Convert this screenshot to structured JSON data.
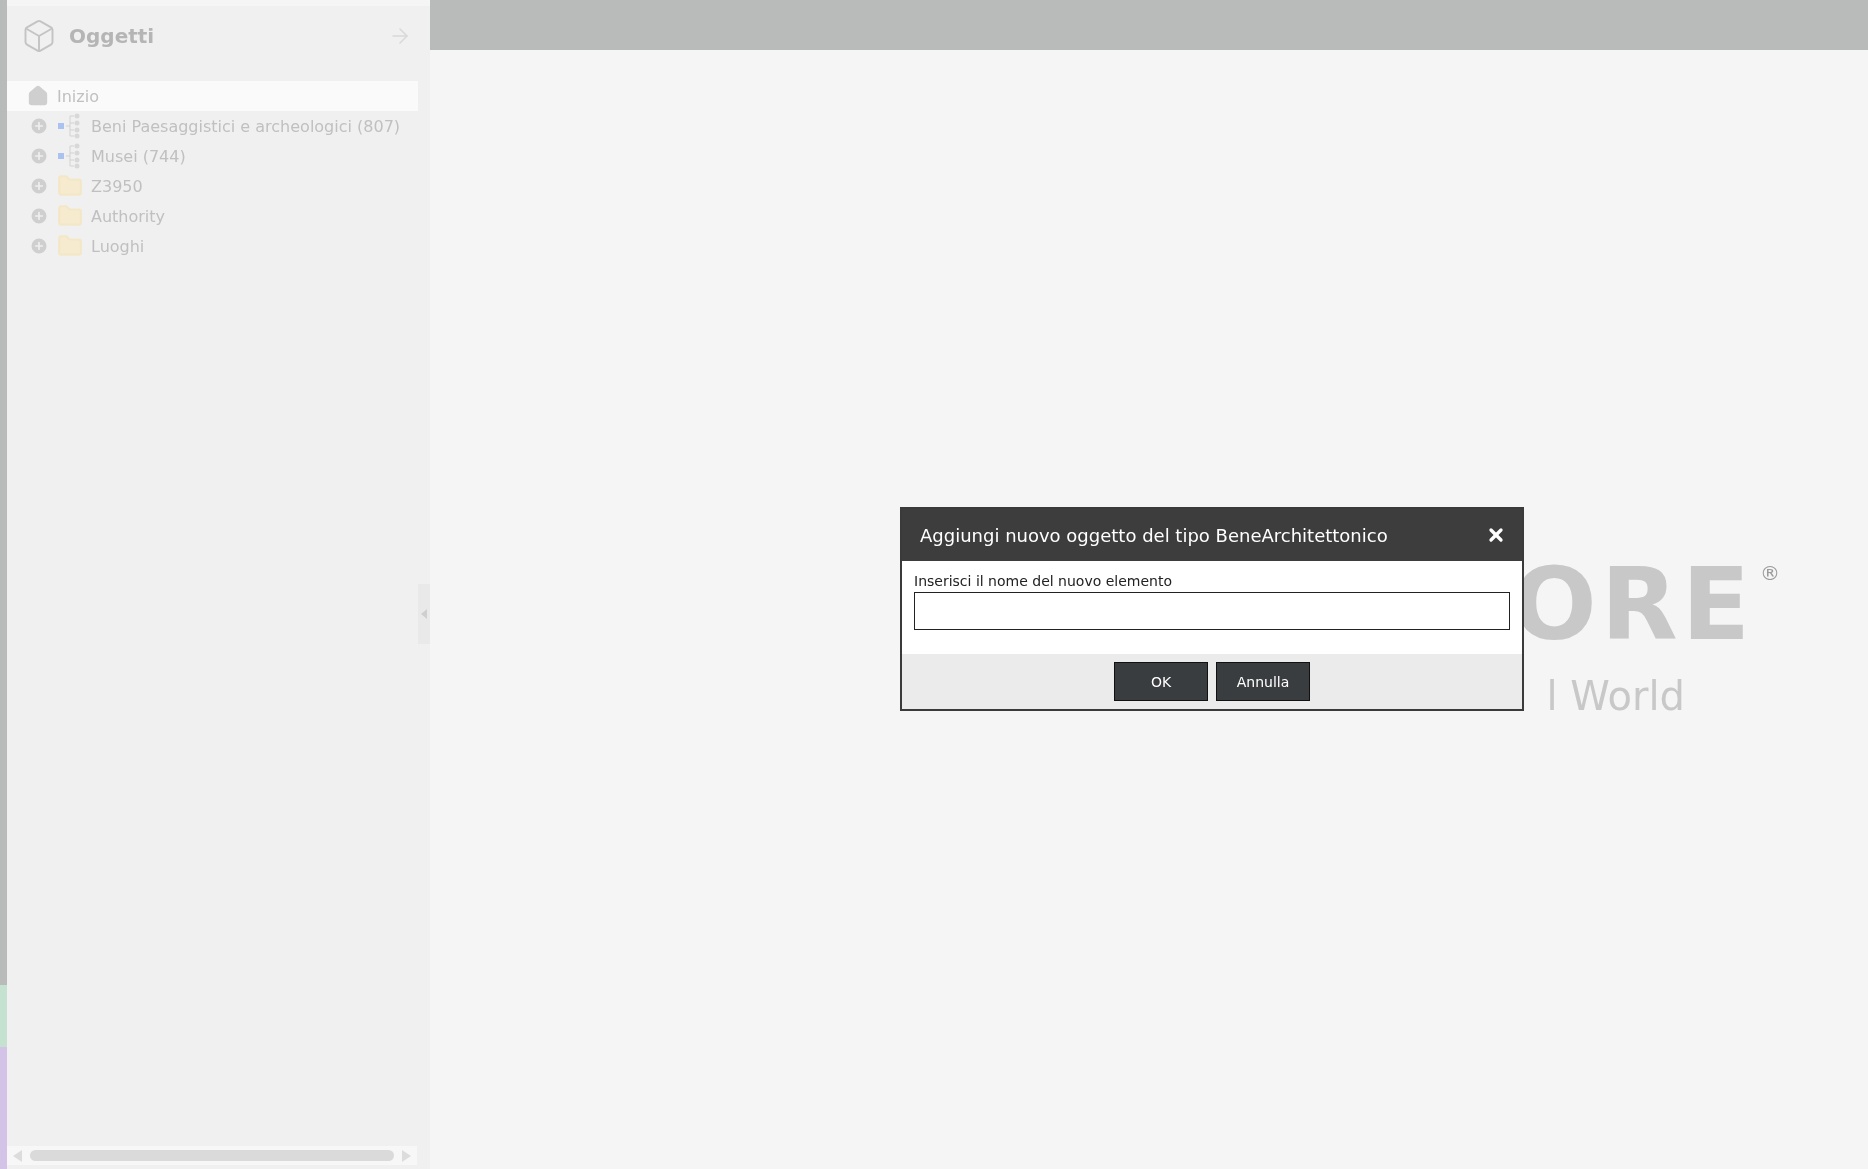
{
  "sidebar": {
    "title": "Oggetti",
    "items": [
      {
        "kind": "home",
        "label": "Inizio",
        "selected": true
      },
      {
        "kind": "tree",
        "label": "Beni Paesaggistici e archeologici (807)",
        "selected": false
      },
      {
        "kind": "tree",
        "label": "Musei (744)",
        "selected": false
      },
      {
        "kind": "folder",
        "label": "Z3950",
        "selected": false
      },
      {
        "kind": "folder",
        "label": "Authority",
        "selected": false
      },
      {
        "kind": "folder",
        "label": "Luoghi",
        "selected": false
      }
    ]
  },
  "logo": {
    "wordmark": "ORE",
    "registered": "®",
    "tagline": "l World"
  },
  "dialog": {
    "title": "Aggiungi nuovo oggetto del tipo BeneArchitettonico",
    "field_label": "Inserisci il nome del nuovo elemento",
    "buttons": [
      "OK",
      "Annulla"
    ]
  }
}
